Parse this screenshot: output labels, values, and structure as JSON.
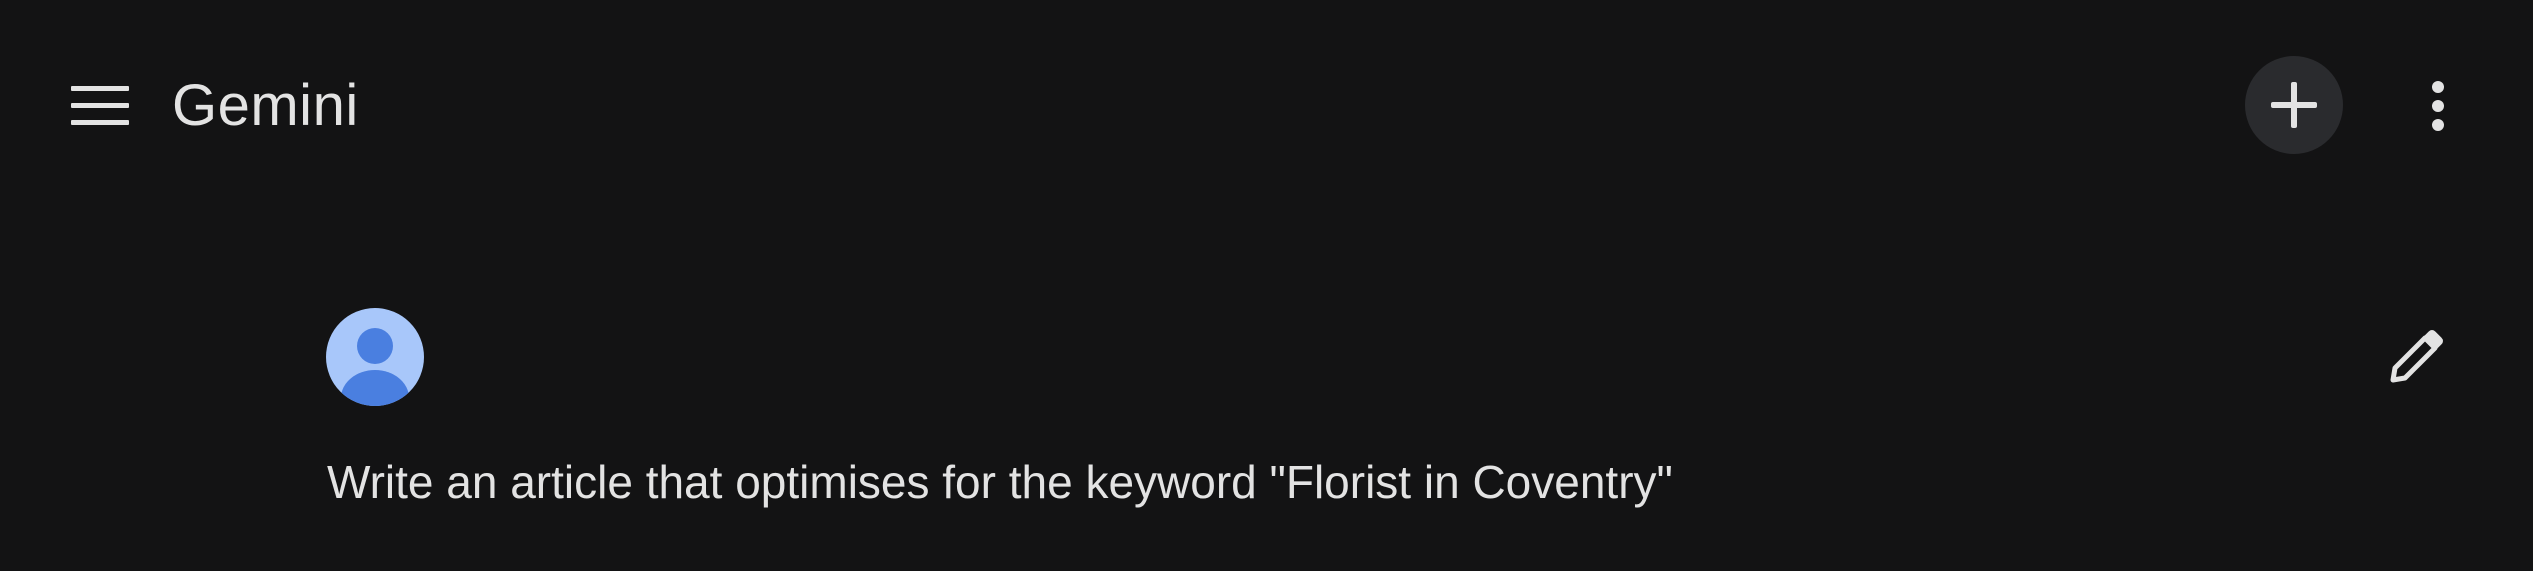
{
  "header": {
    "title": "Gemini",
    "menu_icon": "hamburger-menu-icon",
    "new_chat_icon": "plus-icon",
    "more_icon": "more-vertical-icon"
  },
  "conversation": {
    "user_avatar_icon": "user-avatar-icon",
    "edit_icon": "pencil-edit-icon",
    "prompt": "Write an article that optimises for the keyword \"Florist in Coventry\""
  },
  "colors": {
    "background": "#131314",
    "text": "#e3e3e3",
    "button_bg": "#2a2b2e",
    "avatar_bg": "#a8c7fa",
    "avatar_fg": "#4a7fe0"
  }
}
